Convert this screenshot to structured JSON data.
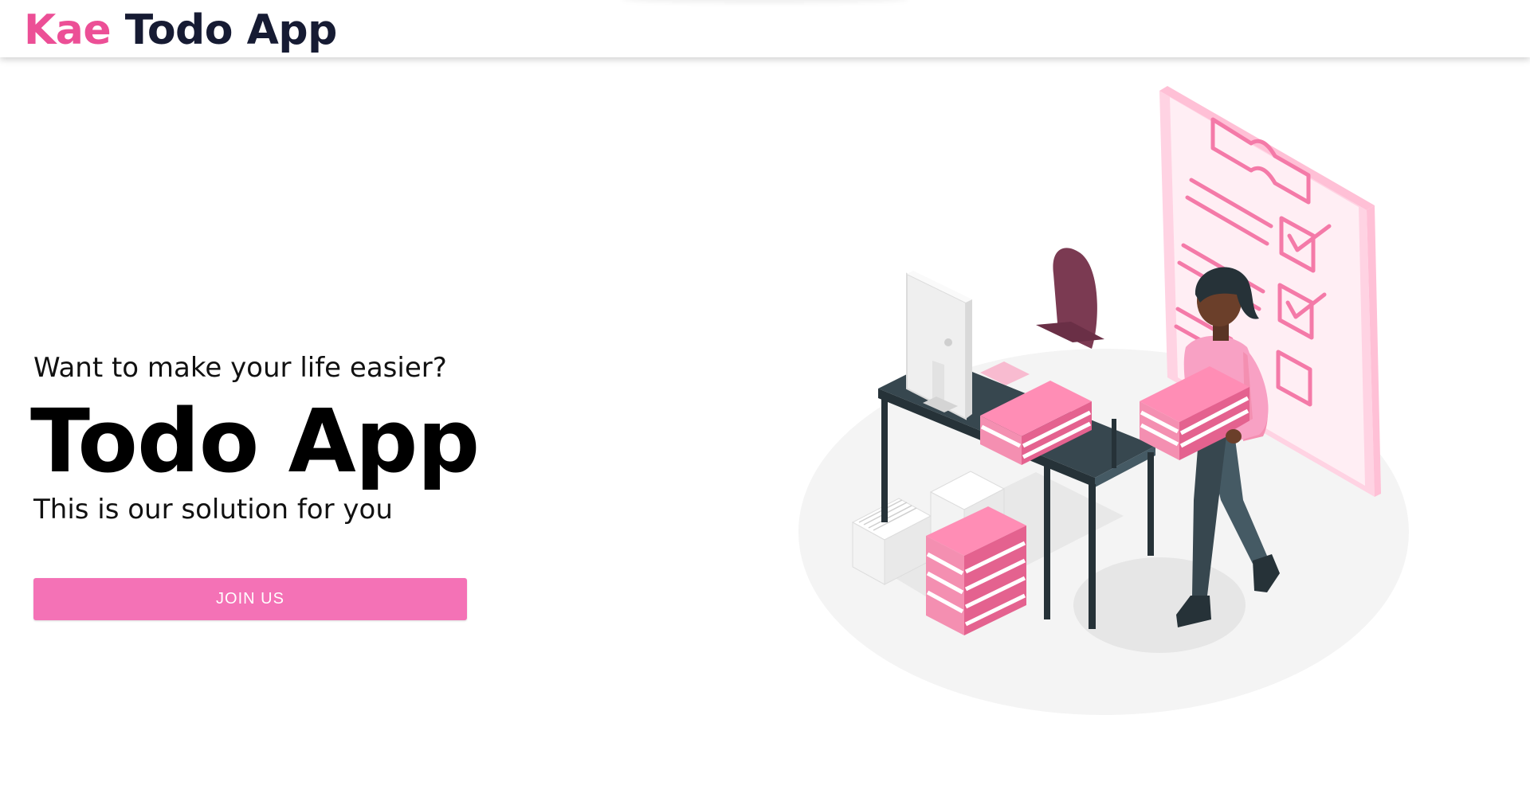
{
  "navbar": {
    "brand_accent": "Kae",
    "brand_rest": " Todo App",
    "accent_color": "#ec4f96"
  },
  "hero": {
    "tagline": "Want to make your life easier?",
    "title": "Todo App",
    "subtitle": "This is our solution for you",
    "cta_label": "JOIN US",
    "cta_color": "#f472b6"
  },
  "illustration": {
    "icon": "woman-carrying-binders-at-desk-illustration"
  }
}
